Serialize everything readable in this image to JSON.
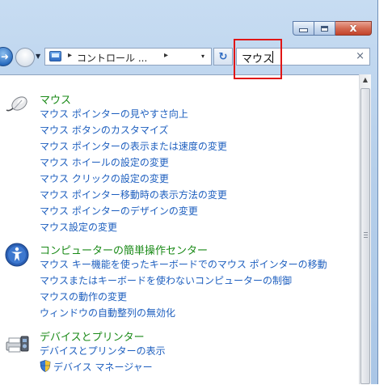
{
  "window": {
    "caption": {
      "min": "minimize",
      "max": "maximize",
      "close": "close"
    },
    "close_glyph": "x"
  },
  "address_bar": {
    "separator": "▸",
    "path_text": "コントロール ...",
    "dropdown": "▾",
    "refresh_glyph": "↻"
  },
  "search": {
    "value": "マウス",
    "clear_glyph": "×"
  },
  "groups": [
    {
      "title": "マウス",
      "icon": "mouse-icon",
      "links": [
        "マウス ポインターの見やすさ向上",
        "マウス ボタンのカスタマイズ",
        "マウス ポインターの表示または速度の変更",
        "マウス ホイールの設定の変更",
        "マウス クリックの設定の変更",
        "マウス ポインター移動時の表示方法の変更",
        "マウス ポインターのデザインの変更",
        "マウス設定の変更"
      ]
    },
    {
      "title": "コンピューターの簡単操作センター",
      "icon": "ease-of-access-icon",
      "links": [
        "マウス キー機能を使ったキーボードでのマウス ポインターの移動",
        "マウスまたはキーボードを使わないコンピューターの制御",
        "マウスの動作の変更",
        "ウィンドウの自動整列の無効化"
      ]
    },
    {
      "title": "デバイスとプリンター",
      "icon": "devices-printers-icon",
      "links": [
        "デバイスとプリンターの表示",
        "デバイス マネージャー"
      ]
    }
  ],
  "colors": {
    "group_title": "#1a8a17",
    "link": "#1e5fbf",
    "highlight": "#e01616"
  }
}
